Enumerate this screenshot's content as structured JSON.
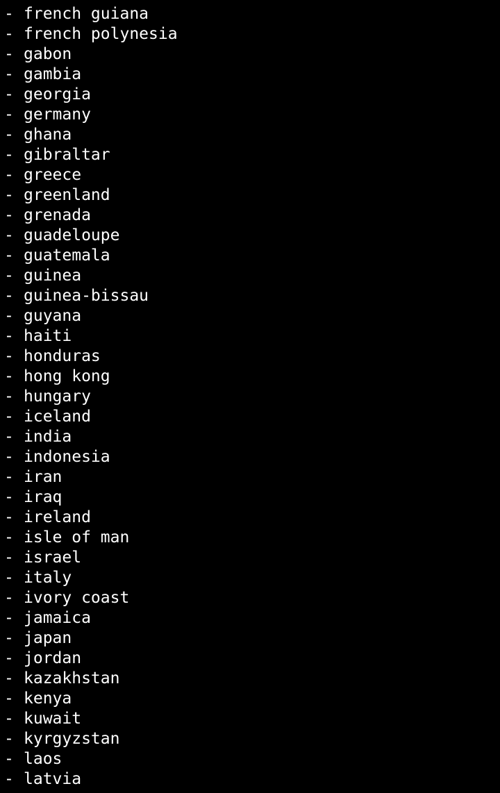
{
  "bullet": "-",
  "colors": {
    "background": "#000000",
    "text": "#ffffff"
  },
  "items": [
    "french guiana",
    "french polynesia",
    "gabon",
    "gambia",
    "georgia",
    "germany",
    "ghana",
    "gibraltar",
    "greece",
    "greenland",
    "grenada",
    "guadeloupe",
    "guatemala",
    "guinea",
    "guinea-bissau",
    "guyana",
    "haiti",
    "honduras",
    "hong kong",
    "hungary",
    "iceland",
    "india",
    "indonesia",
    "iran",
    "iraq",
    "ireland",
    "isle of man",
    "israel",
    "italy",
    "ivory coast",
    "jamaica",
    "japan",
    "jordan",
    "kazakhstan",
    "kenya",
    "kuwait",
    "kyrgyzstan",
    "laos",
    "latvia"
  ]
}
